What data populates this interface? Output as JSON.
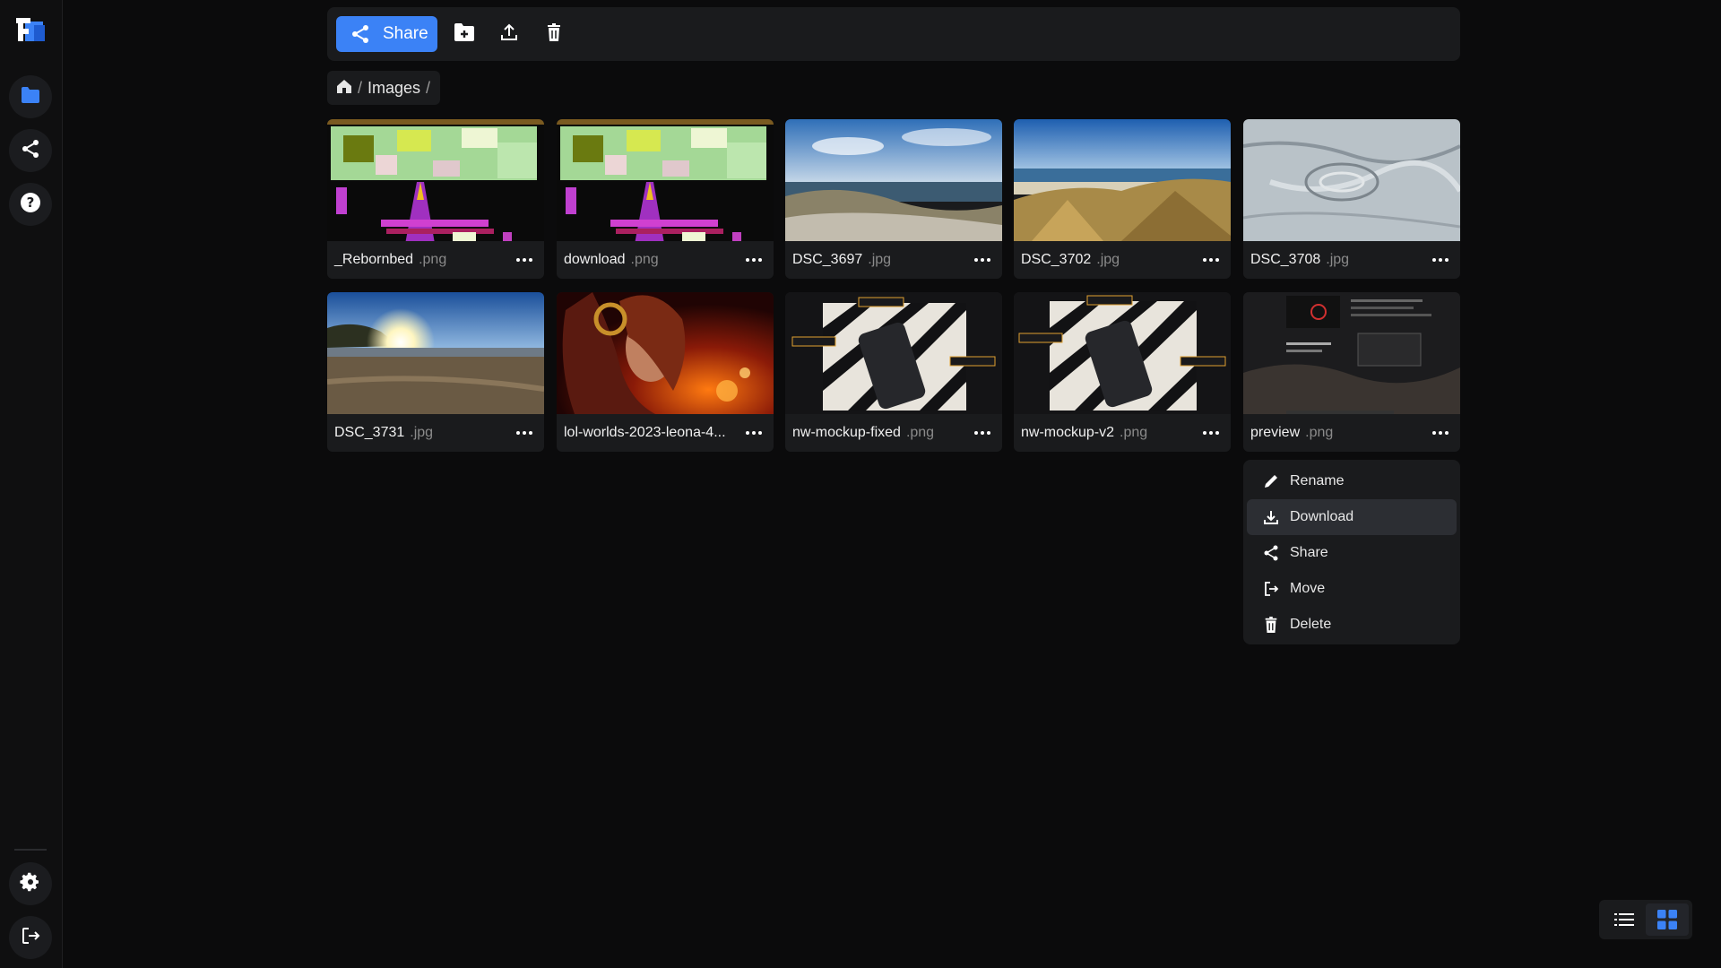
{
  "sidebar": {
    "items": [
      {
        "name": "folder-icon",
        "active": true
      },
      {
        "name": "share-icon"
      },
      {
        "name": "help-icon"
      }
    ],
    "bottom": [
      {
        "name": "settings-icon"
      },
      {
        "name": "logout-icon"
      }
    ]
  },
  "toolbar": {
    "share_label": "Share",
    "icons": [
      "new-folder-icon",
      "upload-icon",
      "trash-icon"
    ]
  },
  "breadcrumb": {
    "items": [
      "Images"
    ]
  },
  "files": [
    {
      "name": "_Rebornbed",
      "ext": ".png",
      "thumb": "pixel-art"
    },
    {
      "name": "download",
      "ext": ".png",
      "thumb": "pixel-art"
    },
    {
      "name": "DSC_3697",
      "ext": ".jpg",
      "thumb": "beach-dunes"
    },
    {
      "name": "DSC_3702",
      "ext": ".jpg",
      "thumb": "beach-grass"
    },
    {
      "name": "DSC_3708",
      "ext": ".jpg",
      "thumb": "sand"
    },
    {
      "name": "DSC_3731",
      "ext": ".jpg",
      "thumb": "sunset-beach"
    },
    {
      "name": "lol-worlds-2023-leona-4...",
      "ext": "",
      "thumb": "fire-portrait"
    },
    {
      "name": "nw-mockup-fixed",
      "ext": ".png",
      "thumb": "phone-mockup"
    },
    {
      "name": "nw-mockup-v2",
      "ext": ".png",
      "thumb": "phone-mockup"
    },
    {
      "name": "preview",
      "ext": ".png",
      "thumb": "dark-ui"
    }
  ],
  "context_menu": {
    "items": [
      {
        "label": "Rename",
        "icon": "pencil-icon"
      },
      {
        "label": "Download",
        "icon": "download-icon",
        "active": true
      },
      {
        "label": "Share",
        "icon": "share-icon"
      },
      {
        "label": "Move",
        "icon": "move-icon"
      },
      {
        "label": "Delete",
        "icon": "trash-icon"
      }
    ]
  },
  "view_toggle": {
    "options": [
      "list-view-icon",
      "grid-view-icon"
    ],
    "active": "grid-view-icon"
  },
  "colors": {
    "accent": "#3b82f6",
    "background": "#0b0b0c",
    "panel": "#1a1b1d"
  }
}
